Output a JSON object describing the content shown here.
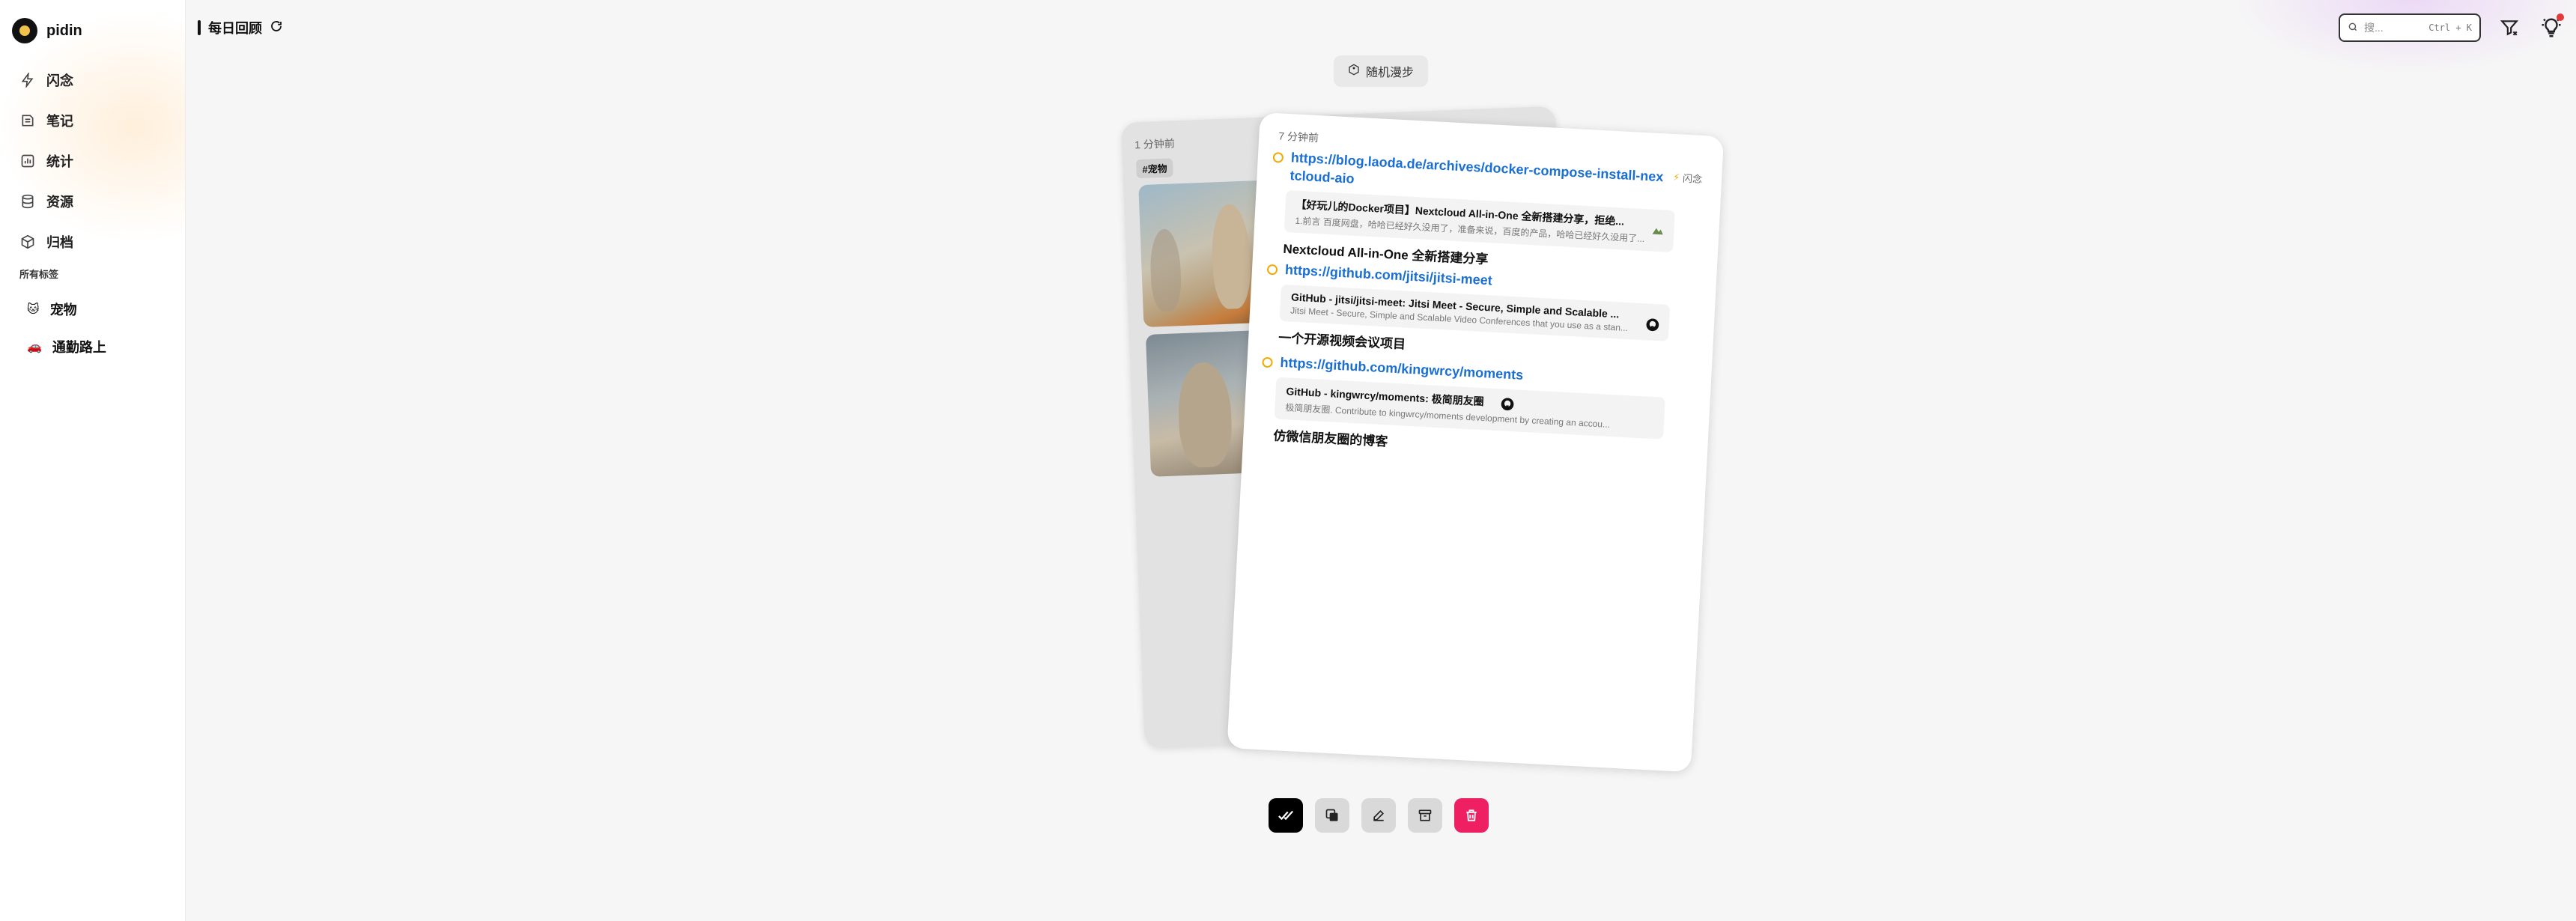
{
  "brand": {
    "name": "pidin"
  },
  "sidebar": {
    "items": [
      {
        "label": "闪念",
        "icon": "lightning-icon"
      },
      {
        "label": "笔记",
        "icon": "notebook-icon"
      },
      {
        "label": "统计",
        "icon": "chart-icon"
      },
      {
        "label": "资源",
        "icon": "database-icon"
      },
      {
        "label": "归档",
        "icon": "archive-icon"
      }
    ],
    "tags_title": "所有标签",
    "tags": [
      {
        "emoji": "🐱",
        "label": "宠物"
      },
      {
        "emoji": "🚗",
        "label": "通勤路上"
      }
    ]
  },
  "header": {
    "title": "每日回顾"
  },
  "search": {
    "placeholder": "搜...",
    "shortcut": "Ctrl + K"
  },
  "random_walk": {
    "label": "随机漫步"
  },
  "back_card": {
    "time": "1 分钟前",
    "tag": "#宠物"
  },
  "front_card": {
    "time": "7 分钟前",
    "type": "闪念",
    "entries": [
      {
        "url": "https://blog.laoda.de/archives/docker-compose-install-nextcloud-aio",
        "preview_title": "【好玩儿的Docker项目】Nextcloud All-in-One 全新搭建分享，拒绝...",
        "preview_desc": "1.前言 百度网盘，哈哈已经好久没用了，准备来说，百度的产品，哈哈已经好久没用了...",
        "note": "Nextcloud All-in-One 全新搭建分享"
      },
      {
        "url": "https://github.com/jitsi/jitsi-meet",
        "preview_title": "GitHub - jitsi/jitsi-meet: Jitsi Meet - Secure, Simple and Scalable ...",
        "preview_desc": "Jitsi Meet - Secure, Simple and Scalable Video Conferences that you use as a stan...",
        "note": "一个开源视频会议项目"
      },
      {
        "url": "https://github.com/kingwrcy/moments",
        "preview_title": "GitHub - kingwrcy/moments: 极简朋友圈",
        "preview_desc": "极简朋友圈. Contribute to kingwrcy/moments development by creating an accou...",
        "note": "仿微信朋友圈的博客"
      }
    ]
  },
  "actions": [
    "done-button",
    "copy-button",
    "edit-button",
    "archive-button",
    "delete-button"
  ],
  "colors": {
    "accent": "#f2a900",
    "link": "#1a6fd4",
    "delete": "#ef1f64"
  }
}
